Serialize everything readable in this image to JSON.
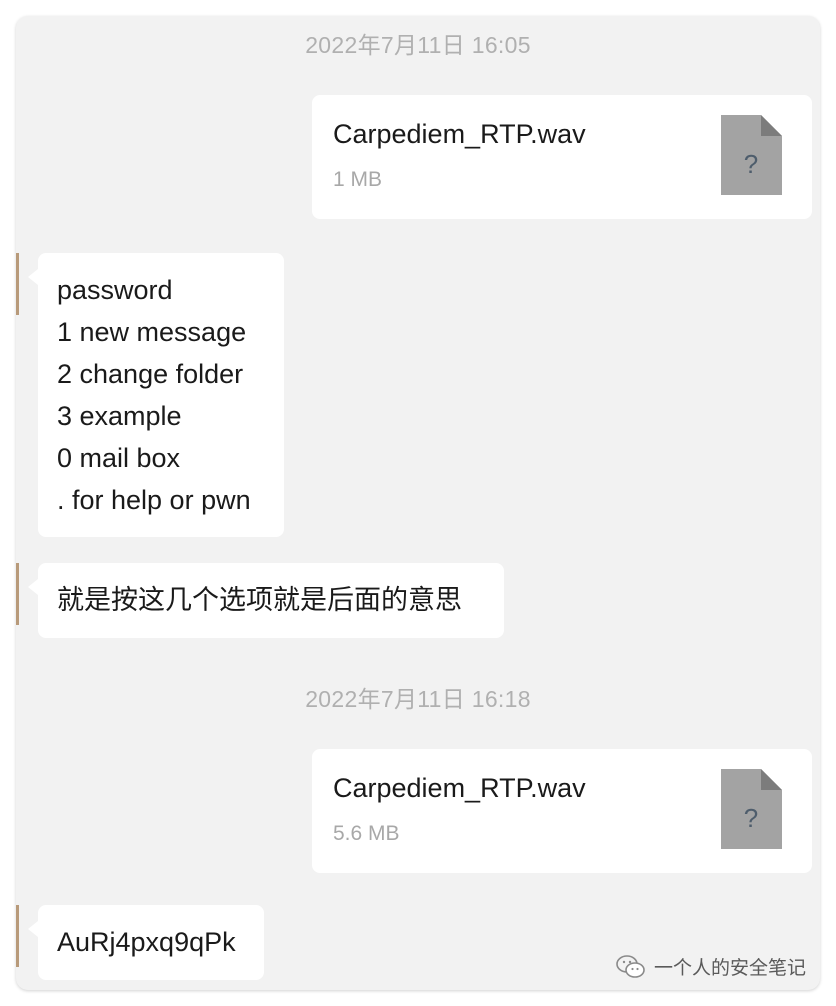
{
  "conversation": {
    "timestamps": [
      "2022年7月11日 16:05",
      "2022年7月11日 16:18"
    ],
    "files": [
      {
        "name": "Carpediem_RTP.wav",
        "size": "1 MB",
        "icon": "unknown-file-icon",
        "icon_glyph": "?"
      },
      {
        "name": "Carpediem_RTP.wav",
        "size": "5.6 MB",
        "icon": "unknown-file-icon",
        "icon_glyph": "?"
      }
    ],
    "messages": [
      {
        "lines": [
          "password",
          "1 new message",
          "2 change folder",
          "3 example",
          "0 mail box",
          ". for help or pwn"
        ]
      },
      {
        "lines": [
          "就是按这几个选项就是后面的意思"
        ]
      },
      {
        "lines": [
          "AuRj4pxq9qPk"
        ]
      }
    ]
  },
  "watermark": {
    "text": "一个人的安全笔记",
    "icon": "wechat-icon"
  },
  "colors": {
    "background": "#f2f2f2",
    "bubble": "#ffffff",
    "timestamp": "#b0b0b0",
    "file_icon": "#a3a3a3"
  }
}
